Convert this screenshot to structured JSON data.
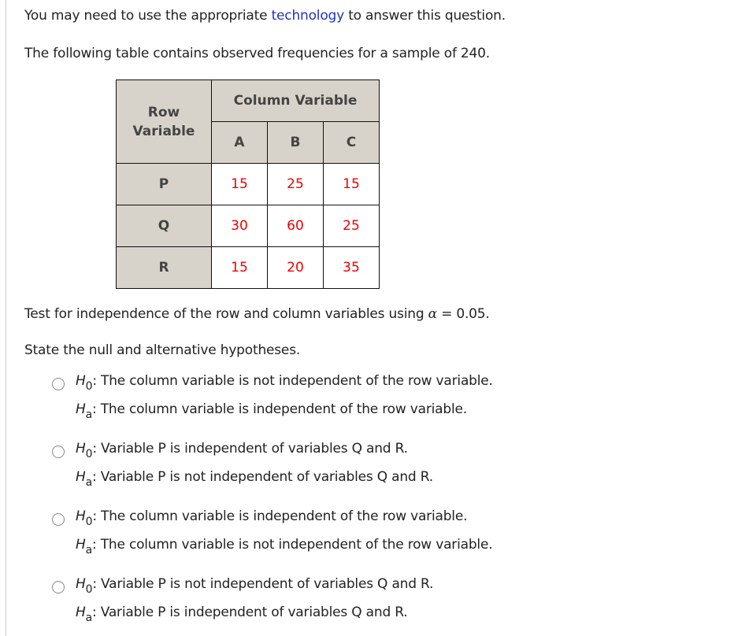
{
  "intro": {
    "before_link": "You may need to use the appropriate ",
    "link_text": "technology",
    "after_link": " to answer this question."
  },
  "table_intro": "The following table contains observed frequencies for a sample of 240.",
  "table": {
    "corner_line1": "Row",
    "corner_line2": "Variable",
    "column_group": "Column Variable",
    "columns": [
      "A",
      "B",
      "C"
    ],
    "rows": [
      {
        "label": "P",
        "values": [
          "15",
          "25",
          "15"
        ]
      },
      {
        "label": "Q",
        "values": [
          "30",
          "60",
          "25"
        ]
      },
      {
        "label": "R",
        "values": [
          "15",
          "20",
          "35"
        ]
      }
    ]
  },
  "test_statement": {
    "before_alpha": "Test for independence of the row and column variables using ",
    "alpha_symbol": "α",
    "after_alpha": " = 0.05."
  },
  "prompt": "State the null and alternative hypotheses.",
  "hypothesis_labels": {
    "H": "H",
    "null_sub": "0",
    "alt_sub": "a",
    "colon": ":"
  },
  "options": [
    {
      "h0": " The column variable is not independent of the row variable.",
      "ha": " The column variable is independent of the row variable.",
      "selected": false
    },
    {
      "h0": " Variable P is independent of variables Q and R.",
      "ha": " Variable P is not independent of variables Q and R.",
      "selected": false
    },
    {
      "h0": " The column variable is independent of the row variable.",
      "ha": " The column variable is not independent of the row variable.",
      "selected": false
    },
    {
      "h0": " Variable P is not independent of variables Q and R.",
      "ha": " Variable P is independent of variables Q and R.",
      "selected": false
    }
  ],
  "colors": {
    "link": "#2233bb",
    "observed_value": "#ee0000",
    "header_bg": "#d8d3ca"
  }
}
